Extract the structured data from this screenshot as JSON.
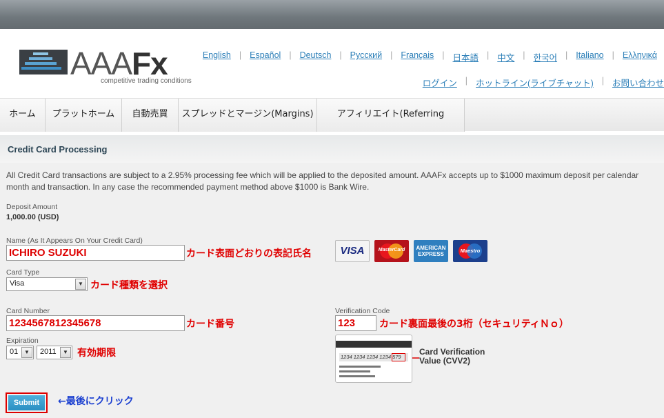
{
  "logo": {
    "text_light": "AAA",
    "text_bold": "Fx",
    "tagline": "competitive trading conditions"
  },
  "languages": [
    "English",
    "Español",
    "Deutsch",
    "Русский",
    "Français",
    "日本語",
    "中文",
    "한국어",
    "Italiano",
    "Ελληνικά"
  ],
  "header_links": [
    "ログイン",
    "ホットライン(ライブチャット)",
    "お問い合わせ"
  ],
  "nav": [
    "ホーム",
    "プラットホーム",
    "自動売買",
    "スプレッドとマージン(Margins)",
    "アフィリエイト(Referring Brokers)"
  ],
  "section_title": "Credit Card Processing",
  "intro_text": "All Credit Card transactions are subject to a 2.95% processing fee which will be applied to the deposited amount. AAAFx accepts up to $1000 maximum deposit per calendar month and transaction. In any case the recommended payment method above $1000 is Bank Wire.",
  "deposit": {
    "label": "Deposit Amount",
    "value": "1,000.00 (USD)"
  },
  "form": {
    "name_label": "Name (As It Appears On Your Credit Card)",
    "name_value": "ICHIRO SUZUKI",
    "card_type_label": "Card Type",
    "card_type_value": "Visa",
    "card_number_label": "Card Number",
    "card_number_value": "1234567812345678",
    "expiration_label": "Expiration",
    "exp_month": "01",
    "exp_year": "2011",
    "verification_label": "Verification Code",
    "verification_value": "123",
    "submit_label": "Submit"
  },
  "card_logos": {
    "visa": "VISA",
    "mastercard": "MasterCard",
    "amex_line1": "AMERICAN",
    "amex_line2": "EXPRESS",
    "maestro": "Maestro"
  },
  "cvv_illustration": {
    "card_digits": "1234 1234 1234 1234",
    "code": "579",
    "label_line1": "Card Verification",
    "label_line2": "Value (CVV2)"
  },
  "annotations": {
    "name": "カード表面どおりの表記氏名",
    "card_type": "カード種類を選択",
    "card_number": "カード番号",
    "verification": "カード裏面最後の3桁（セキュリティＮｏ）",
    "expiration": "有効期限",
    "submit": "←最後にクリック"
  },
  "colors": {
    "link": "#2c7fb8",
    "annotation_red": "#e00000",
    "annotation_blue": "#1a3fd0",
    "submit": "#2a8fc2"
  }
}
